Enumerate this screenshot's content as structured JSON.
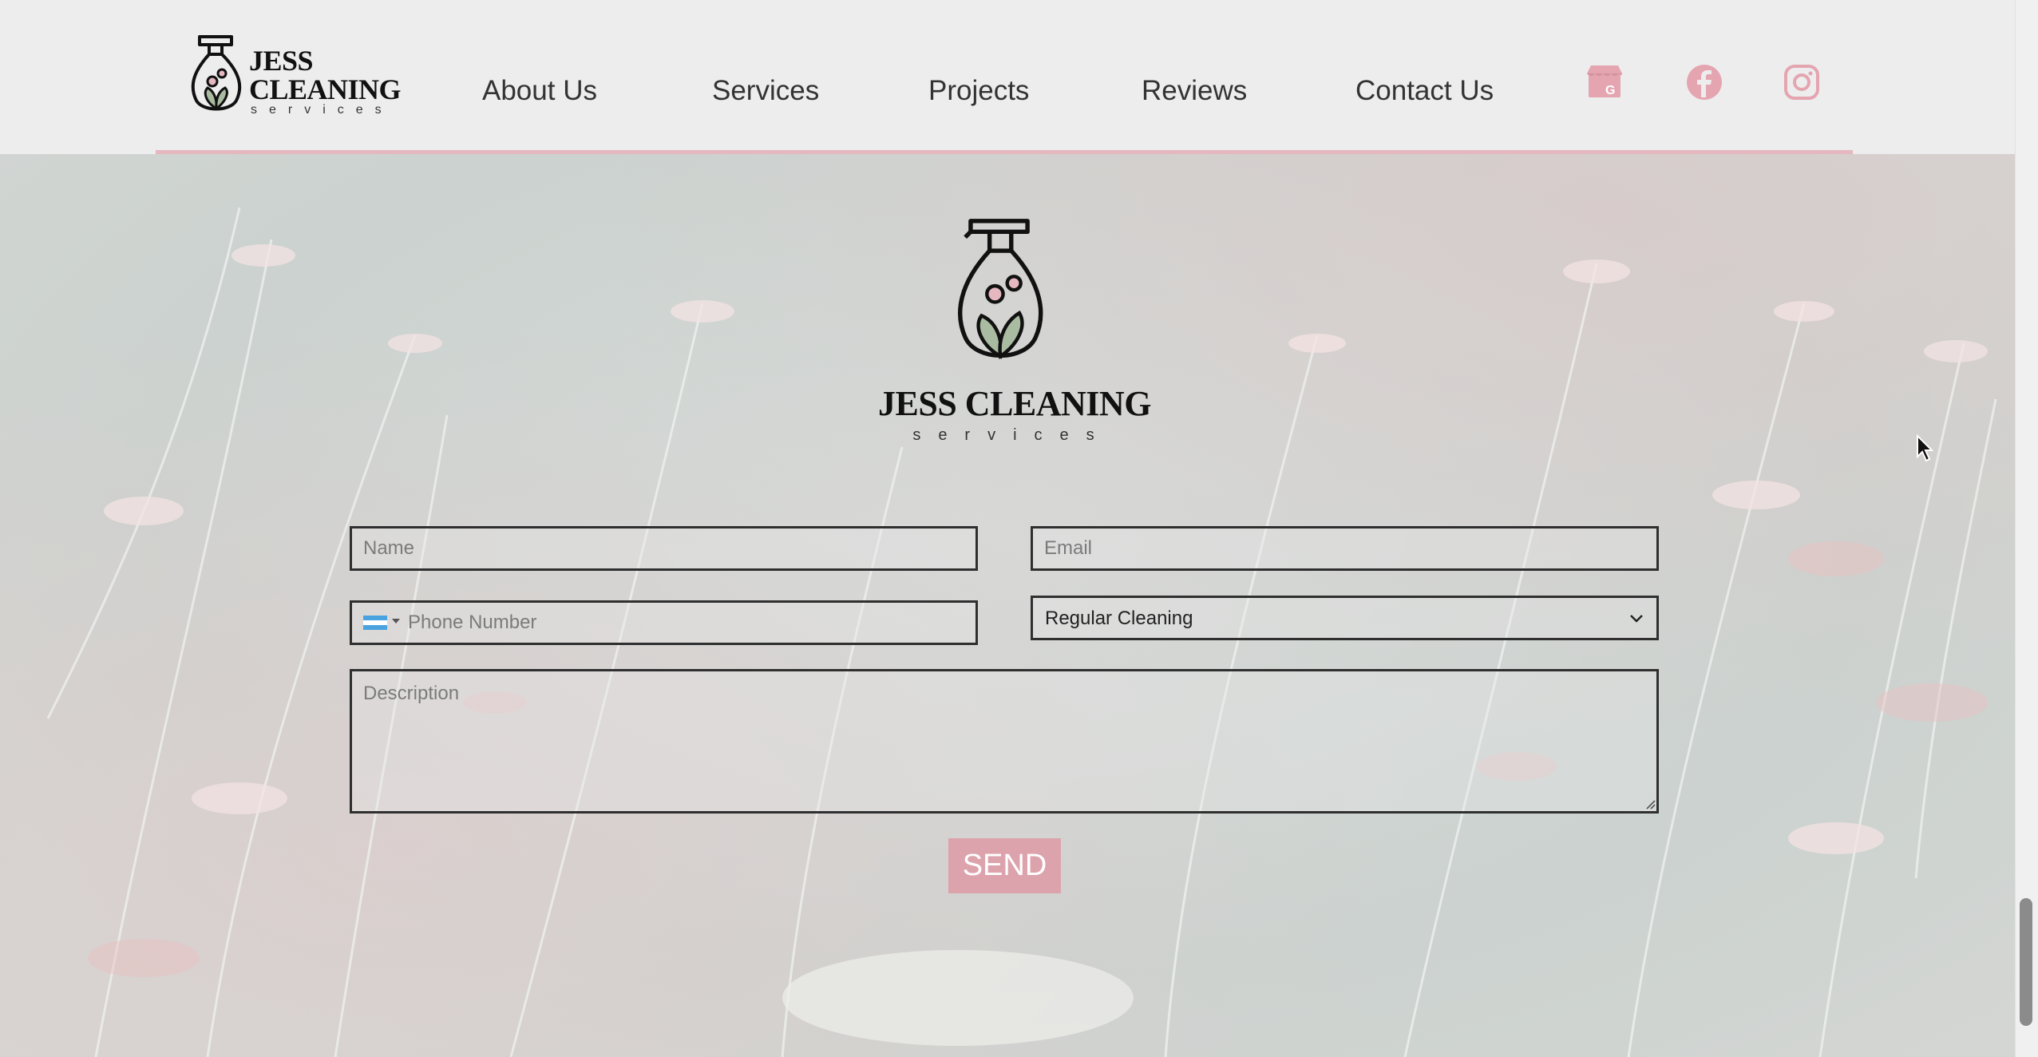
{
  "header": {
    "logo": {
      "title_line1": "JESS",
      "title_line2": "CLEANING",
      "subtitle": "services"
    },
    "nav": [
      "About Us",
      "Services",
      "Projects",
      "Reviews",
      "Contact Us"
    ],
    "social": [
      "google-business-icon",
      "facebook-icon",
      "instagram-icon"
    ]
  },
  "brand": {
    "title": "JESS CLEANING",
    "subtitle": "services",
    "colors": {
      "accent": "#e5b7bf",
      "button": "#dca3ad",
      "leaf": "#a9bba0"
    }
  },
  "form": {
    "name_placeholder": "Name",
    "email_placeholder": "Email",
    "phone_placeholder": "Phone Number",
    "service_selected": "Regular Cleaning",
    "description_placeholder": "Description",
    "send_label": "SEND"
  }
}
